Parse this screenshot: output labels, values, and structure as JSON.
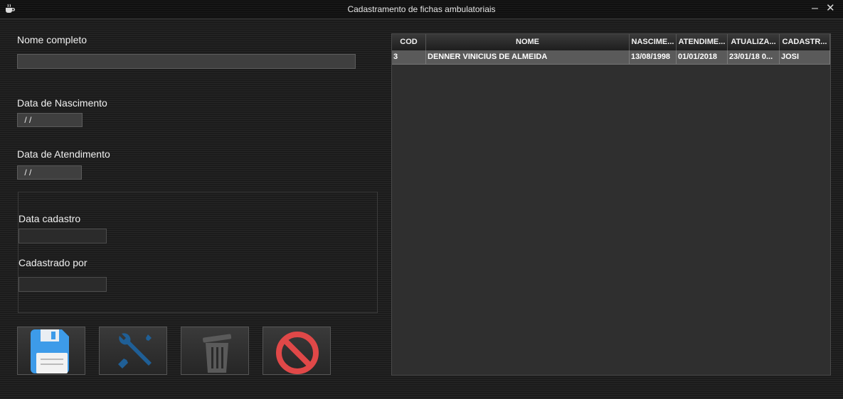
{
  "window": {
    "title": "Cadastramento de fichas ambulatoriais",
    "icon": "coffee-cup-icon",
    "minimize_glyph": "–",
    "close_glyph": "✕"
  },
  "form": {
    "nome_label": "Nome completo",
    "nome_value": "",
    "nascimento_label": "Data de Nascimento",
    "nascimento_value": " / /",
    "atendimento_label": "Data de Atendimento",
    "atendimento_value": " / /",
    "cadastro_label": "Data cadastro",
    "cadastro_value": "",
    "cadastrado_por_label": "Cadastrado por",
    "cadastrado_por_value": ""
  },
  "toolbar": {
    "buttons": [
      {
        "name": "save",
        "icon": "floppy-disk-icon"
      },
      {
        "name": "edit",
        "icon": "tools-icon"
      },
      {
        "name": "delete",
        "icon": "trash-icon"
      },
      {
        "name": "cancel",
        "icon": "no-entry-icon"
      }
    ]
  },
  "table": {
    "columns": [
      "COD",
      "NOME",
      "NASCIME...",
      "ATENDIME...",
      "ATUALIZA...",
      "CADASTR..."
    ],
    "rows": [
      [
        "3",
        "DENNER VINICIUS DE ALMEIDA",
        "13/08/1998",
        "01/01/2018",
        "23/01/18 0...",
        "JOSI"
      ]
    ]
  },
  "colors": {
    "save_blue": "#3d9be9",
    "tools_blue": "#1f5f96",
    "cancel_red": "#e04848",
    "trash_gray": "#5a5a5a",
    "selected_row": "#5a5a5a"
  }
}
